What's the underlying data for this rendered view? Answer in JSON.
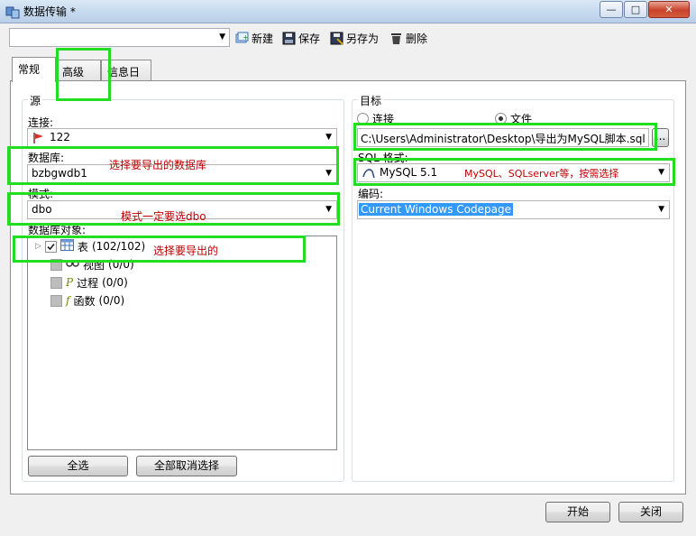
{
  "window": {
    "title": "数据传输 *",
    "min_label": "—",
    "max_label": "□",
    "close_label": "✕"
  },
  "toolbar": {
    "profile_value": "",
    "new_label": "新建",
    "save_label": "保存",
    "save_as_label": "另存为",
    "delete_label": "删除"
  },
  "tabs": [
    {
      "label": "常规"
    },
    {
      "label": "高级"
    },
    {
      "label": "信息日志"
    }
  ],
  "source": {
    "group_label": "源",
    "connection_label": "连接:",
    "connection_value": "122",
    "database_label": "数据库:",
    "database_value": "bzbgwdb1",
    "schema_label": "模式:",
    "schema_value": "dbo",
    "objects_label": "数据库对象:",
    "objects": [
      {
        "label": "表",
        "count": "(102/102)"
      },
      {
        "label": "视图",
        "count": "(0/0)"
      },
      {
        "label": "过程",
        "count": "(0/0)"
      },
      {
        "label": "函数",
        "count": "(0/0)"
      }
    ],
    "select_all_label": "全选",
    "deselect_all_label": "全部取消选择"
  },
  "target": {
    "group_label": "目标",
    "connection_option": "连接",
    "file_option": "文件",
    "file_path": "C:\\Users\\Administrator\\Desktop\\导出为MySQL脚本.sql",
    "browse_label": "...",
    "sql_format_label": "SQL 格式:",
    "sql_format_value": "MySQL 5.1",
    "encoding_label": "编码:",
    "encoding_value": "Current Windows Codepage"
  },
  "annotations": {
    "database_note": "选择要导出的数据库",
    "schema_note": "模式一定要选dbo",
    "objects_note": "选择要导出的",
    "format_note": "MySQL、SQLserver等，按需选择"
  },
  "footer": {
    "start_label": "开始",
    "close_label": "关闭"
  },
  "colors": {
    "annotation_box": "#22dd22",
    "annotation_text": "#c00000",
    "selection": "#3399ff"
  }
}
